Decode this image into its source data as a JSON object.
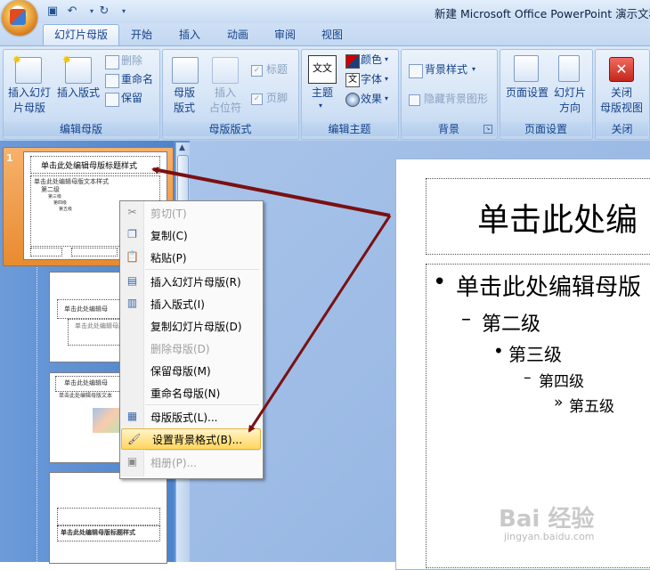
{
  "window": {
    "title": "新建 Microsoft Office PowerPoint 演示文稿"
  },
  "quick_access": {
    "icons": [
      "save-icon",
      "undo-icon",
      "redo-icon",
      "customize-icon"
    ]
  },
  "tabs": [
    {
      "label": "幻灯片母版",
      "active": true
    },
    {
      "label": "开始"
    },
    {
      "label": "插入"
    },
    {
      "label": "动画"
    },
    {
      "label": "审阅"
    },
    {
      "label": "视图"
    }
  ],
  "ribbon": {
    "edit_master": {
      "label": "编辑母版",
      "insert_slide_master_l1": "插入幻灯",
      "insert_slide_master_l2": "片母版",
      "insert_layout": "插入版式",
      "delete": "删除",
      "rename": "重命名",
      "preserve": "保留"
    },
    "master_layout": {
      "label": "母版版式",
      "master_layout_l1": "母版",
      "master_layout_l2": "版式",
      "insert_placeholder_l1": "插入",
      "insert_placeholder_l2": "占位符",
      "title": "标题",
      "footer": "页脚"
    },
    "edit_theme": {
      "label": "编辑主题",
      "themes": "主题",
      "colors": "颜色",
      "fonts": "字体",
      "effects": "效果",
      "theme_glyph": "文文"
    },
    "background": {
      "label": "背景",
      "background_styles": "背景样式",
      "hide_bg_graphics": "隐藏背景图形"
    },
    "page_setup": {
      "label": "页面设置",
      "page_setup": "页面设置",
      "slide_orientation_l1": "幻灯片",
      "slide_orientation_l2": "方向"
    },
    "close": {
      "label": "关闭",
      "close_master_l1": "关闭",
      "close_master_l2": "母版视图"
    }
  },
  "thumbnails": {
    "slide_number": "1",
    "slide1_title": "单击此处编辑母版标题样式",
    "slide1_body": "单击此处编辑母版文本样式",
    "slide1_l2": "第二级",
    "slide1_l3": "第三级",
    "slide1_l4": "第四级",
    "slide1_l5": "第五级",
    "slide2_title": "单击此处编辑母",
    "slide2_sub": "单击此处编辑母版副标",
    "slide3_title": "单击此处编辑母",
    "slide3_body": "单击此处编辑母版文本",
    "slide4_title": "单击此处编辑母版标题样式"
  },
  "main_slide": {
    "title_placeholder": "单击此处编",
    "levels": [
      {
        "bullet": "•",
        "text": "单击此处编辑母版"
      },
      {
        "bullet": "–",
        "text": "第二级"
      },
      {
        "bullet": "•",
        "text": "第三级"
      },
      {
        "bullet": "–",
        "text": "第四级"
      },
      {
        "bullet": "»",
        "text": "第五级"
      }
    ]
  },
  "context_menu": {
    "items": [
      {
        "label": "剪切(T)",
        "icon": "scissors-icon",
        "disabled": true
      },
      {
        "label": "复制(C)",
        "icon": "copy-icon"
      },
      {
        "label": "粘贴(P)",
        "icon": "paste-icon"
      },
      {
        "label": "插入幻灯片母版(R)",
        "icon": "insert-master-icon"
      },
      {
        "label": "插入版式(I)",
        "icon": "insert-layout-icon"
      },
      {
        "label": "复制幻灯片母版(D)",
        "icon": ""
      },
      {
        "label": "删除母版(D)",
        "icon": "",
        "disabled": true
      },
      {
        "label": "保留母版(M)",
        "icon": ""
      },
      {
        "label": "重命名母版(N)",
        "icon": ""
      },
      {
        "label": "母版版式(L)...",
        "icon": "master-layout-icon"
      },
      {
        "label": "设置背景格式(B)...",
        "icon": "format-background-icon",
        "highlighted": true
      },
      {
        "label": "相册(P)...",
        "icon": "photo-album-icon",
        "disabled": true
      }
    ]
  },
  "watermark": {
    "brand": "Bai 经验",
    "url": "jingyan.baidu.com"
  },
  "colors": {
    "ribbon_text": "#15428b",
    "arrow": "#7a1012",
    "selection": "#f0a050"
  }
}
